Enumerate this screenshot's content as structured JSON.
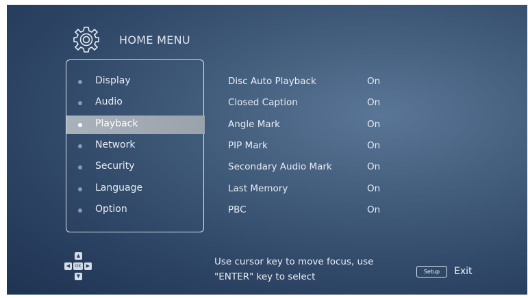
{
  "header": {
    "title": "HOME MENU",
    "icon": "gear-icon"
  },
  "menu": {
    "items": [
      {
        "label": "Display",
        "selected": false
      },
      {
        "label": "Audio",
        "selected": false
      },
      {
        "label": "Playback",
        "selected": true
      },
      {
        "label": "Network",
        "selected": false
      },
      {
        "label": "Security",
        "selected": false
      },
      {
        "label": "Language",
        "selected": false
      },
      {
        "label": "Option",
        "selected": false
      }
    ]
  },
  "settings": [
    {
      "name": "Disc Auto Playback",
      "value": "On"
    },
    {
      "name": "Closed Caption",
      "value": "On"
    },
    {
      "name": "Angle Mark",
      "value": "On"
    },
    {
      "name": "PIP Mark",
      "value": "On"
    },
    {
      "name": "Secondary Audio Mark",
      "value": "On"
    },
    {
      "name": "Last Memory",
      "value": "On"
    },
    {
      "name": "PBC",
      "value": "On"
    }
  ],
  "footer": {
    "dpad_ok_label": "OK",
    "hint_line1": "Use cursor key to move focus, use",
    "hint_line2": "\"ENTER\" key to select",
    "setup_button": "Setup",
    "exit_label": "Exit"
  },
  "colors": {
    "background": "#2b4262",
    "highlight": "#a9b1bb",
    "text": "#e8edf3"
  }
}
